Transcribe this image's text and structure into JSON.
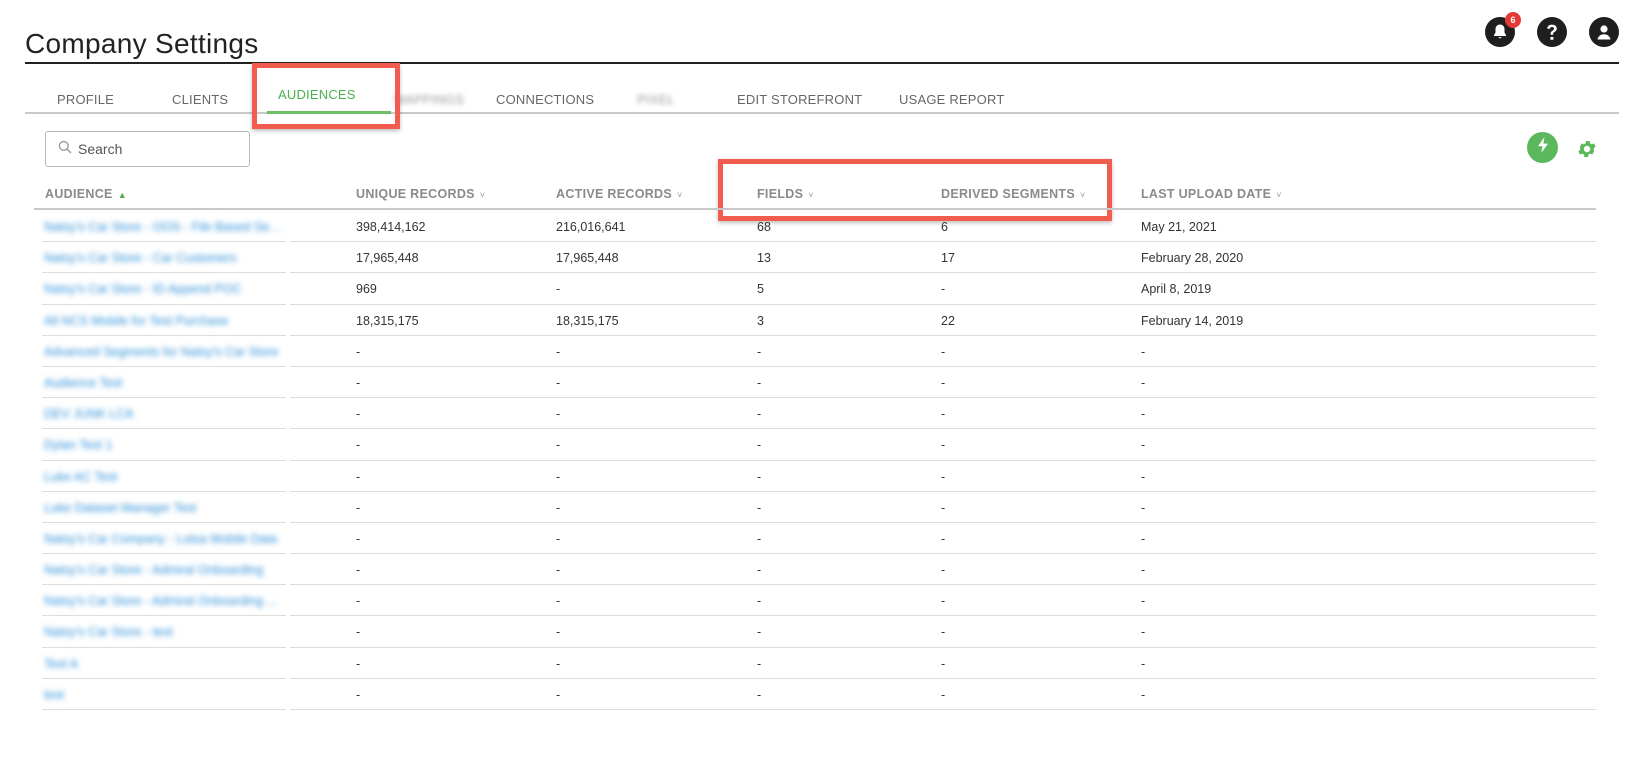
{
  "header": {
    "title": "Company Settings",
    "notification_count": "6"
  },
  "tabs": [
    {
      "label": "PROFILE"
    },
    {
      "label": "CLIENTS"
    },
    {
      "label": "AUDIENCES",
      "active": true
    },
    {
      "label": "MAPPINGS",
      "blurred": true
    },
    {
      "label": "CONNECTIONS"
    },
    {
      "label": "PIXEL",
      "blurred": true
    },
    {
      "label": "EDIT STOREFRONT"
    },
    {
      "label": "USAGE REPORT"
    }
  ],
  "search": {
    "placeholder": "Search",
    "value": ""
  },
  "table": {
    "columns": [
      {
        "label": "AUDIENCE",
        "sort": "asc"
      },
      {
        "label": "UNIQUE RECORDS",
        "sort": "none"
      },
      {
        "label": "ACTIVE RECORDS",
        "sort": "none"
      },
      {
        "label": "FIELDS",
        "sort": "none"
      },
      {
        "label": "DERIVED SEGMENTS",
        "sort": "none"
      },
      {
        "label": "LAST UPLOAD DATE",
        "sort": "none"
      }
    ],
    "rows": [
      {
        "audience": "Natsy's Car Store - OOS - File Based Seg...",
        "unique": "398,414,162",
        "active": "216,016,641",
        "fields": "68",
        "segments": "6",
        "date": "May 21, 2021"
      },
      {
        "audience": "Natsy's Car Store - Car Customers",
        "unique": "17,965,448",
        "active": "17,965,448",
        "fields": "13",
        "segments": "17",
        "date": "February 28, 2020"
      },
      {
        "audience": "Natsy's Car Store - ID Append POC",
        "unique": "969",
        "active": "-",
        "fields": "5",
        "segments": "-",
        "date": "April 8, 2019"
      },
      {
        "audience": "All NCS Mobile for Test Purchase",
        "unique": "18,315,175",
        "active": "18,315,175",
        "fields": "3",
        "segments": "22",
        "date": "February 14, 2019"
      },
      {
        "audience": "Advanced Segments for Natsy's Car Store",
        "unique": "-",
        "active": "-",
        "fields": "-",
        "segments": "-",
        "date": "-"
      },
      {
        "audience": "Audience Test",
        "unique": "-",
        "active": "-",
        "fields": "-",
        "segments": "-",
        "date": "-"
      },
      {
        "audience": "DEV JUNK LCA",
        "unique": "-",
        "active": "-",
        "fields": "-",
        "segments": "-",
        "date": "-"
      },
      {
        "audience": "Dylan Test 1",
        "unique": "-",
        "active": "-",
        "fields": "-",
        "segments": "-",
        "date": "-"
      },
      {
        "audience": "Luke AC Test",
        "unique": "-",
        "active": "-",
        "fields": "-",
        "segments": "-",
        "date": "-"
      },
      {
        "audience": "Luke Dataset Manager Test",
        "unique": "-",
        "active": "-",
        "fields": "-",
        "segments": "-",
        "date": "-"
      },
      {
        "audience": "Natsy's Car Company - Lotsa Mobile Data",
        "unique": "-",
        "active": "-",
        "fields": "-",
        "segments": "-",
        "date": "-"
      },
      {
        "audience": "Natsy's Car Store - Admiral Onboarding",
        "unique": "-",
        "active": "-",
        "fields": "-",
        "segments": "-",
        "date": "-"
      },
      {
        "audience": "Natsy's Car Store - Admiral Onboarding ...",
        "unique": "-",
        "active": "-",
        "fields": "-",
        "segments": "-",
        "date": "-"
      },
      {
        "audience": "Natsy's Car Store - test",
        "unique": "-",
        "active": "-",
        "fields": "-",
        "segments": "-",
        "date": "-"
      },
      {
        "audience": "Test A",
        "unique": "-",
        "active": "-",
        "fields": "-",
        "segments": "-",
        "date": "-"
      },
      {
        "audience": "test",
        "unique": "-",
        "active": "-",
        "fields": "-",
        "segments": "-",
        "date": "-"
      }
    ]
  },
  "icons": {
    "notifications": "bell-icon",
    "help": "question-icon",
    "account": "user-icon",
    "search": "search-icon",
    "quick_action": "lightning-bolt-icon",
    "settings": "gear-icon"
  },
  "colors": {
    "accent_green": "#4caf50",
    "link_blue": "#2e8fd8",
    "highlight_red": "#f25c4f",
    "badge_red": "#e53935"
  }
}
